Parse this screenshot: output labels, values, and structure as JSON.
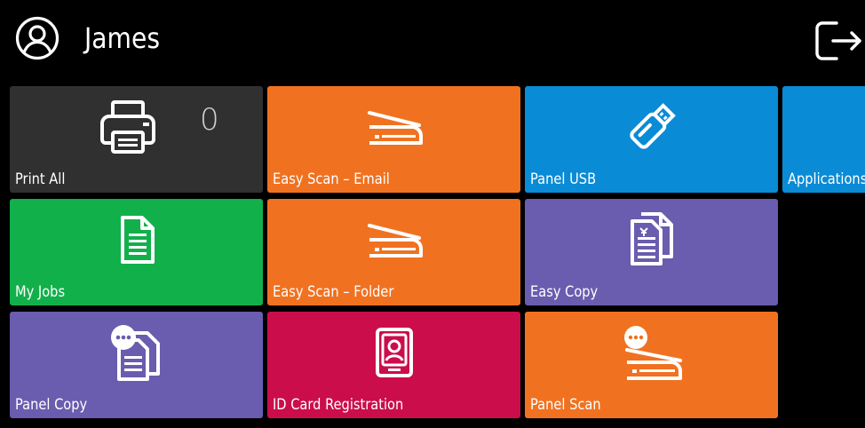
{
  "header": {
    "user_name": "James",
    "user_icon": "user-circle-icon",
    "logout_icon": "logout-icon"
  },
  "colors": {
    "background": "#000000",
    "dark_gray": "#303030",
    "orange": "#f07221",
    "blue": "#0a8bd6",
    "green": "#12b04b",
    "purple": "#6a5cae",
    "crimson": "#cb0d4c"
  },
  "tiles": {
    "print_all": {
      "label": "Print All",
      "count": "0",
      "icon": "printer-icon",
      "color": "#303030"
    },
    "easy_scan_email": {
      "label": "Easy Scan – Email",
      "icon": "scanner-icon",
      "color": "#f07221"
    },
    "panel_usb": {
      "label": "Panel USB",
      "icon": "usb-drive-icon",
      "color": "#0a8bd6"
    },
    "applications": {
      "label": "Applications",
      "color": "#0a8bd6"
    },
    "my_jobs": {
      "label": "My Jobs",
      "icon": "document-icon",
      "color": "#12b04b"
    },
    "easy_scan_folder": {
      "label": "Easy Scan – Folder",
      "icon": "scanner-icon",
      "color": "#f07221"
    },
    "easy_copy": {
      "label": "Easy Copy",
      "icon": "copy-documents-icon",
      "color": "#6a5cae"
    },
    "panel_copy": {
      "label": "Panel Copy",
      "icon": "panel-copy-icon",
      "color": "#6a5cae"
    },
    "id_card_registration": {
      "label": "ID Card Registration",
      "icon": "id-card-icon",
      "color": "#cb0d4c"
    },
    "panel_scan": {
      "label": "Panel Scan",
      "icon": "panel-scan-icon",
      "color": "#f07221"
    }
  }
}
